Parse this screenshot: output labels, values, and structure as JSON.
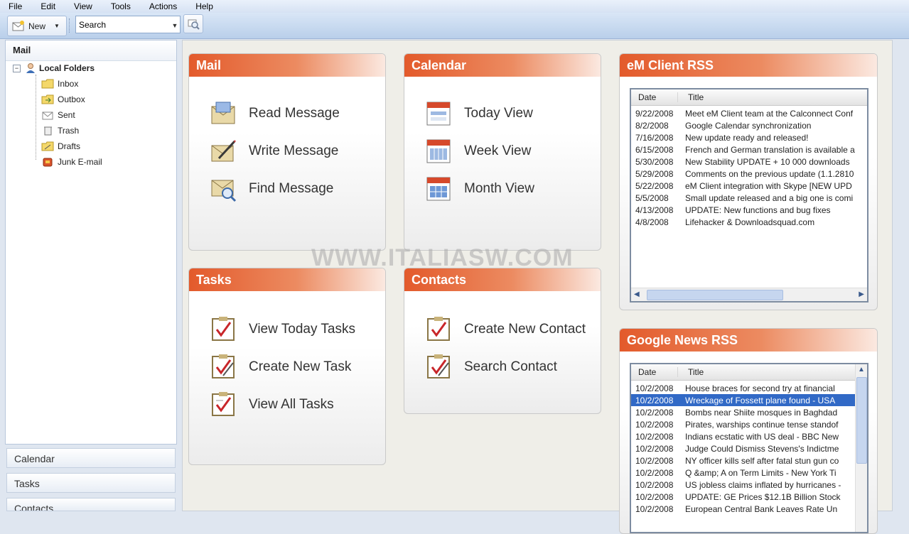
{
  "menu": [
    "File",
    "Edit",
    "View",
    "Tools",
    "Actions",
    "Help"
  ],
  "toolbar": {
    "new_label": "New",
    "search_value": "Search"
  },
  "sidebar": {
    "title": "Mail",
    "root": "Local Folders",
    "folders": [
      "Inbox",
      "Outbox",
      "Sent",
      "Trash",
      "Drafts",
      "Junk E-mail"
    ],
    "nav": [
      "Calendar",
      "Tasks",
      "Contacts"
    ]
  },
  "panels": {
    "mail": {
      "title": "Mail",
      "actions": [
        "Read Message",
        "Write Message",
        "Find Message"
      ]
    },
    "calendar": {
      "title": "Calendar",
      "actions": [
        "Today View",
        "Week View",
        "Month View"
      ]
    },
    "tasks": {
      "title": "Tasks",
      "actions": [
        "View Today Tasks",
        "Create New Task",
        "View All Tasks"
      ]
    },
    "contacts": {
      "title": "Contacts",
      "actions": [
        "Create New Contact",
        "Search Contact"
      ]
    }
  },
  "rss_emclient": {
    "title": "eM Client RSS",
    "col_date": "Date",
    "col_title": "Title",
    "rows": [
      {
        "date": "9/22/2008",
        "title": "Meet eM Client team at the Calconnect Conf"
      },
      {
        "date": "8/2/2008",
        "title": "Google Calendar synchronization"
      },
      {
        "date": "7/16/2008",
        "title": "New update ready and released!"
      },
      {
        "date": "6/15/2008",
        "title": "French and German translation is available a"
      },
      {
        "date": "5/30/2008",
        "title": "New Stability UPDATE + 10 000 downloads"
      },
      {
        "date": "5/29/2008",
        "title": "Comments on the previous update (1.1.2810"
      },
      {
        "date": "5/22/2008",
        "title": "eM Client integration with Skype [NEW UPD"
      },
      {
        "date": "5/5/2008",
        "title": "Small update released and a big one is comi"
      },
      {
        "date": "4/13/2008",
        "title": "UPDATE: New functions and bug fixes"
      },
      {
        "date": "4/8/2008",
        "title": "Lifehacker & Downloadsquad.com"
      }
    ]
  },
  "rss_google": {
    "title": "Google News RSS",
    "col_date": "Date",
    "col_title": "Title",
    "rows": [
      {
        "date": "10/2/2008",
        "title": "House braces for second try at financial"
      },
      {
        "date": "10/2/2008",
        "title": "Wreckage of Fossett plane found - USA"
      },
      {
        "date": "10/2/2008",
        "title": "Bombs near Shiite mosques in Baghdad"
      },
      {
        "date": "10/2/2008",
        "title": "Pirates, warships continue tense standof"
      },
      {
        "date": "10/2/2008",
        "title": "Indians ecstatic with US deal - BBC New"
      },
      {
        "date": "10/2/2008",
        "title": "Judge Could Dismiss Stevens's Indictme"
      },
      {
        "date": "10/2/2008",
        "title": "NY officer kills self after fatal stun gun co"
      },
      {
        "date": "10/2/2008",
        "title": "Q &amp; A on Term Limits - New York Ti"
      },
      {
        "date": "10/2/2008",
        "title": "US jobless claims inflated by hurricanes -"
      },
      {
        "date": "10/2/2008",
        "title": "UPDATE: GE Prices $12.1B Billion Stock"
      },
      {
        "date": "10/2/2008",
        "title": "European Central Bank Leaves Rate Un"
      }
    ],
    "selected_index": 1
  },
  "watermark": "WWW.ITALIASW.COM"
}
